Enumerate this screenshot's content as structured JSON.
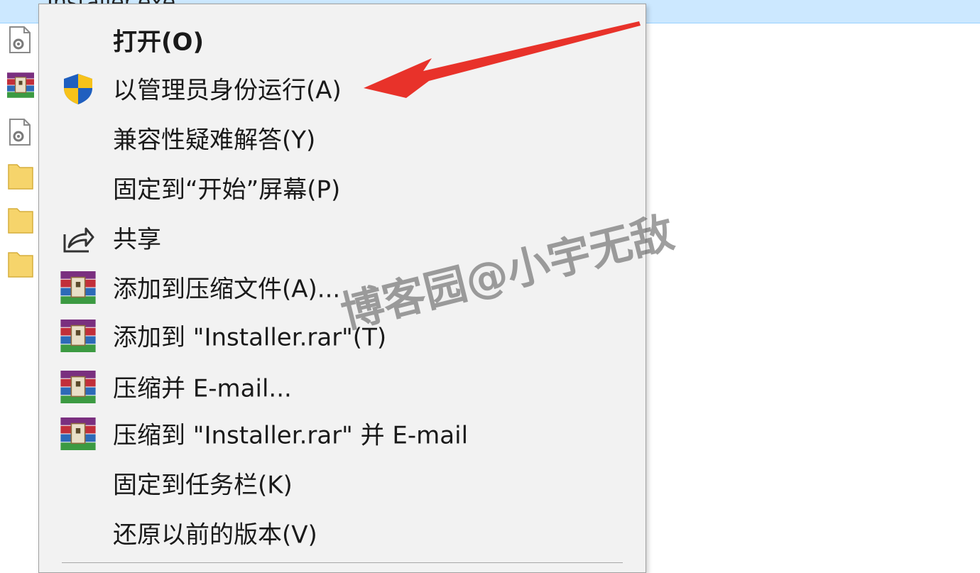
{
  "explorer": {
    "selected_item_label": "Installer.exe",
    "rows": [
      {
        "icon": "gear-file-icon"
      },
      {
        "icon": "winrar-icon"
      },
      {
        "icon": "gear-file-icon"
      },
      {
        "icon": "folder-icon"
      },
      {
        "icon": "folder-icon"
      },
      {
        "icon": "folder-icon"
      }
    ]
  },
  "context_menu": {
    "items": [
      {
        "label": "打开(O)",
        "icon": "",
        "bold": true
      },
      {
        "label": "以管理员身份运行(A)",
        "icon": "uac-shield-icon"
      },
      {
        "label": "兼容性疑难解答(Y)",
        "icon": ""
      },
      {
        "label": "固定到“开始”屏幕(P)",
        "icon": ""
      },
      {
        "label": "共享",
        "icon": "share-icon"
      },
      {
        "label": "添加到压缩文件(A)...",
        "icon": "winrar-icon"
      },
      {
        "label": "添加到 \"Installer.rar\"(T)",
        "icon": "winrar-icon"
      },
      {
        "label": "压缩并 E-mail...",
        "icon": "winrar-icon"
      },
      {
        "label": "压缩到 \"Installer.rar\" 并 E-mail",
        "icon": "winrar-icon"
      },
      {
        "label": "固定到任务栏(K)",
        "icon": ""
      },
      {
        "label": "还原以前的版本(V)",
        "icon": ""
      }
    ]
  },
  "annotation": {
    "arrow_color": "#e8322a",
    "watermark_text": "博客园@小宇无敌"
  },
  "colors": {
    "selection": "#cce8ff",
    "menu_background": "#f2f2f2",
    "folder": "#f6d46b",
    "shield_blue": "#1f5fbf",
    "shield_yellow": "#f7c21a"
  }
}
